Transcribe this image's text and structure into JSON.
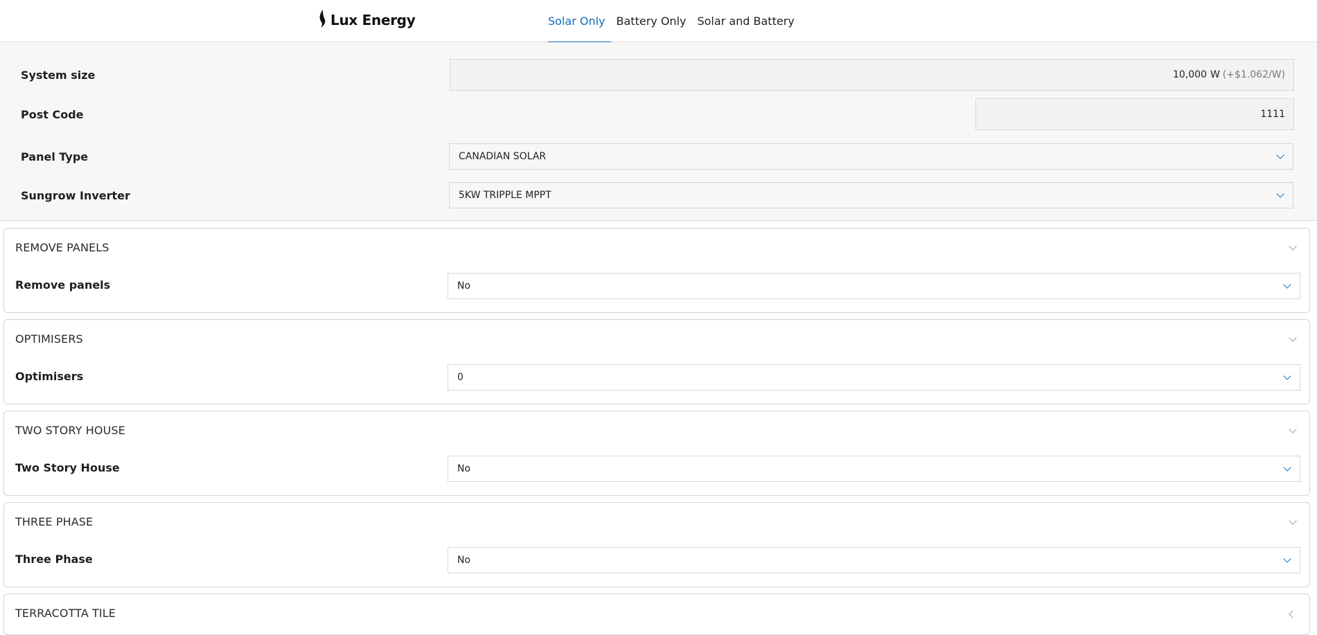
{
  "header": {
    "logo_text": "Lux Energy",
    "tabs": [
      {
        "label": "Solar Only",
        "active": true
      },
      {
        "label": "Battery Only",
        "active": false
      },
      {
        "label": "Solar and Battery",
        "active": false
      }
    ]
  },
  "settings": {
    "system_size": {
      "label": "System size",
      "value": "10,000",
      "unit": "W",
      "price": "(+$1.062/W)"
    },
    "post_code": {
      "label": "Post Code",
      "value": "1111"
    },
    "panel_type": {
      "label": "Panel Type",
      "value": "CANADIAN SOLAR"
    },
    "inverter": {
      "label": "Sungrow Inverter",
      "value": "5KW TRIPPLE MPPT"
    }
  },
  "sections": [
    {
      "title": "REMOVE PANELS",
      "field_label": "Remove panels",
      "value": "No"
    },
    {
      "title": "OPTIMISERS",
      "field_label": "Optimisers",
      "value": "0"
    },
    {
      "title": "TWO STORY HOUSE",
      "field_label": "Two Story House",
      "value": "No"
    },
    {
      "title": "THREE PHASE",
      "field_label": "Three Phase",
      "value": "No"
    },
    {
      "title": "TERRACOTTA TILE"
    }
  ],
  "colors": {
    "accent": "#0f6cbd",
    "panel_bg": "#f7f7f7",
    "border": "#d3d3d3"
  },
  "icons": {
    "logo": "flame-logo-icon",
    "select": "chevron-down-icon",
    "collapse": "chevron-icon"
  }
}
